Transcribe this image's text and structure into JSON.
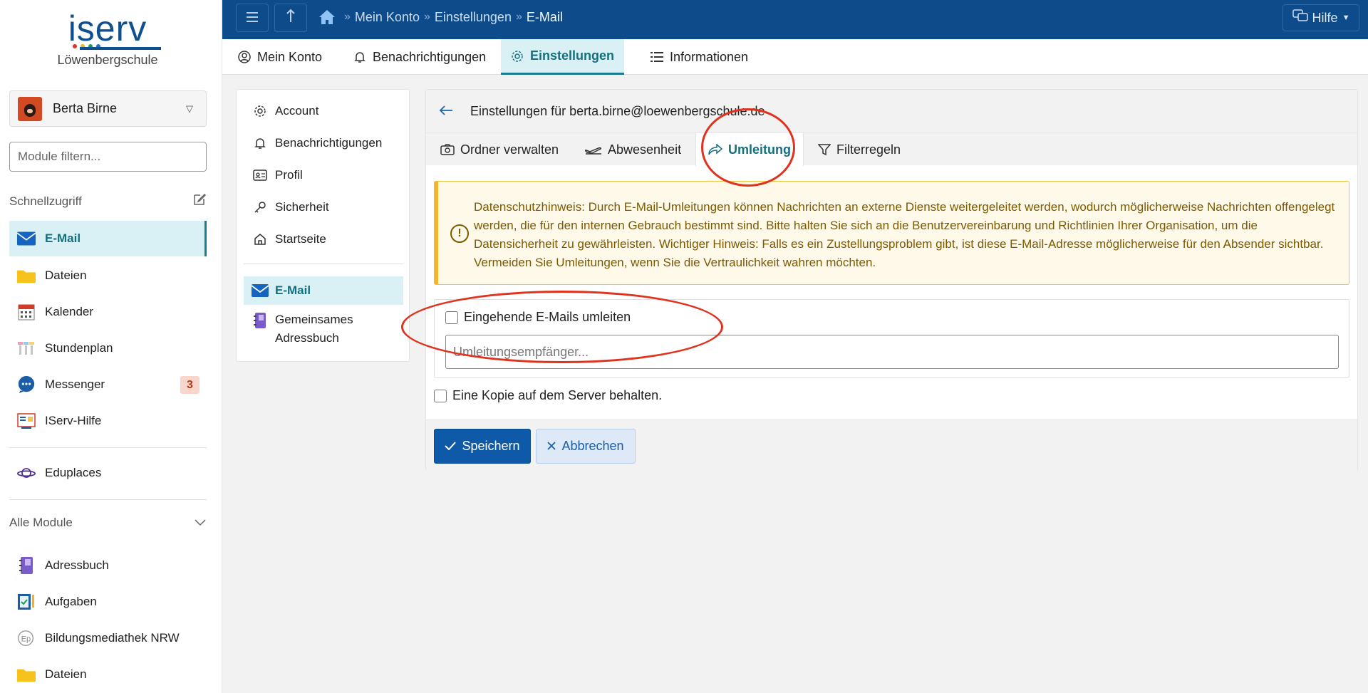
{
  "sidebar": {
    "logo_text": "iserv",
    "school": "Löwenbergschule",
    "user_name": "Berta Birne",
    "filter_placeholder": "Module filtern...",
    "quick_access_label": "Schnellzugriff",
    "quick_items": [
      {
        "label": "E-Mail",
        "icon": "mail-icon",
        "active": true
      },
      {
        "label": "Dateien",
        "icon": "folder-icon"
      },
      {
        "label": "Kalender",
        "icon": "calendar-icon"
      },
      {
        "label": "Stundenplan",
        "icon": "timetable-icon"
      },
      {
        "label": "Messenger",
        "icon": "chat-icon",
        "badge": "3"
      },
      {
        "label": "IServ-Hilfe",
        "icon": "help-book-icon"
      }
    ],
    "eduplaces_label": "Eduplaces",
    "all_modules_label": "Alle Module",
    "module_items": [
      {
        "label": "Adressbuch",
        "icon": "addressbook-icon"
      },
      {
        "label": "Aufgaben",
        "icon": "tasks-icon"
      },
      {
        "label": "Bildungsmediathek NRW",
        "icon": "mediathek-icon"
      },
      {
        "label": "Dateien",
        "icon": "folder-icon"
      }
    ]
  },
  "topbar": {
    "breadcrumb": [
      "Mein Konto",
      "Einstellungen",
      "E-Mail"
    ],
    "help_label": "Hilfe"
  },
  "tabs": [
    {
      "label": "Mein Konto",
      "icon": "user-circle-icon"
    },
    {
      "label": "Benachrichtigungen",
      "icon": "bell-icon"
    },
    {
      "label": "Einstellungen",
      "icon": "gear-icon",
      "active": true
    },
    {
      "label": "Informationen",
      "icon": "list-icon"
    }
  ],
  "settings_menu": [
    {
      "label": "Account",
      "icon": "gear-icon"
    },
    {
      "label": "Benachrichtigungen",
      "icon": "bell-icon"
    },
    {
      "label": "Profil",
      "icon": "id-card-icon"
    },
    {
      "label": "Sicherheit",
      "icon": "key-icon"
    },
    {
      "label": "Startseite",
      "icon": "home-icon"
    },
    {
      "label": "E-Mail",
      "icon": "mail-icon",
      "active": true
    },
    {
      "label": "Gemeinsames Adressbuch",
      "icon": "addressbook-icon"
    }
  ],
  "card": {
    "title": "Einstellungen für berta.birne@loewenbergschule.de",
    "tabs": [
      {
        "label": "Ordner verwalten",
        "icon": "camera-icon"
      },
      {
        "label": "Abwesenheit",
        "icon": "plane-icon"
      },
      {
        "label": "Umleitung",
        "icon": "share-icon",
        "active": true
      },
      {
        "label": "Filterregeln",
        "icon": "filter-icon"
      }
    ],
    "alert_text": "Datenschutzhinweis: Durch E-Mail-Umleitungen können Nachrichten an externe Dienste weitergeleitet werden, wodurch möglicherweise Nachrichten offengelegt werden, die für den internen Gebrauch bestimmt sind. Bitte halten Sie sich an die Benutzervereinbarung und Richtlinien Ihrer Organisation, um die Datensicherheit zu gewährleisten. Wichtiger Hinweis: Falls es ein Zustellungsproblem gibt, ist diese E-Mail-Adresse möglicherweise für den Absender sichtbar. Vermeiden Sie Umleitungen, wenn Sie die Vertraulichkeit wahren möchten.",
    "redirect_checkbox_label": "Eingehende E-Mails umleiten",
    "recipient_placeholder": "Umleitungsempfänger...",
    "keep_copy_label": "Eine Kopie auf dem Server behalten.",
    "save_label": "Speichern",
    "cancel_label": "Abbrechen"
  },
  "colors": {
    "topbar": "#0e4b8a",
    "accent": "#14707f",
    "active_bg": "#d9f0f5",
    "alert_border": "#f2b52b",
    "annotation": "#e0321d"
  }
}
